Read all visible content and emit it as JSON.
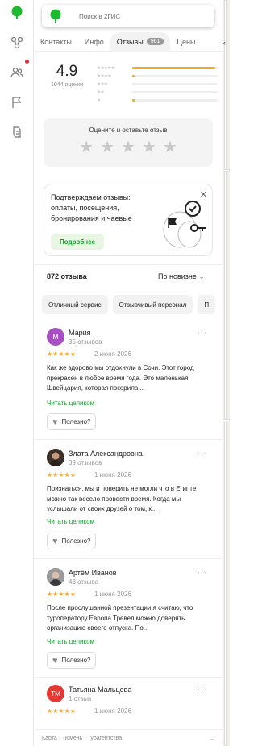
{
  "search": {
    "placeholder": "Поиск в 2ГИС"
  },
  "tabs": [
    {
      "label": "Контакты"
    },
    {
      "label": "Инфо"
    },
    {
      "label": "Отзывы",
      "badge": "961",
      "active": true
    },
    {
      "label": "Цены"
    }
  ],
  "rating": {
    "value": "4.9",
    "count_label": "1044 оценки",
    "distribution": [
      {
        "stars": "★★★★★",
        "fraction": 0.97
      },
      {
        "stars": "★★★★",
        "fraction": 0.03
      },
      {
        "stars": "★★★",
        "fraction": 0.0
      },
      {
        "stars": "★★",
        "fraction": 0.0
      },
      {
        "stars": "★",
        "fraction": 0.03
      }
    ]
  },
  "rate_box": {
    "title": "Оцените и оставьте отзыв"
  },
  "promo": {
    "text": "Подтверждаем отзывы: оплаты, посещения, бронирования и чаевые",
    "button": "Подробнее"
  },
  "reviews_header": {
    "count": "872 отзыва",
    "sort": "По новизне"
  },
  "chips": [
    "Отличный сервис",
    "Отзывчивый персонал",
    "П"
  ],
  "reviews": [
    {
      "initial": "М",
      "avatar_color": "#a94fc5",
      "name": "Мария",
      "sub": "35 отзывов",
      "stars": "★★★★★",
      "date": "2 июня 2026",
      "text": "Как же здорово мы отдохнули в Сочи. Этот город прекрасен в любое время года. Это маленькая Швейцария, которая покорила...",
      "read_more": "Читать целиком",
      "useful": "Полезно?"
    },
    {
      "initial": "",
      "avatar_color": "#5a4a3c",
      "name": "Злата Александровна",
      "sub": "39 отзывов",
      "stars": "★★★★★",
      "date": "1 июня 2026",
      "text": "Признаться, мы и поверить не могли что в Египте можно так весело провести время. Когда мы услышали от своих друзей о том, к...",
      "read_more": "Читать целиком",
      "useful": "Полезно?"
    },
    {
      "initial": "",
      "avatar_color": "#6b6b6b",
      "name": "Артём Иванов",
      "sub": "43 отзыва",
      "stars": "★★★★★",
      "date": "1 июня 2026",
      "text": "После прослушанной презентации я считаю, что туроператору Европа Тревел можно доверять организацию своего отпуска. По...",
      "read_more": "Читать целиком",
      "useful": "Полезно?"
    },
    {
      "initial": "ТМ",
      "avatar_color": "#e53935",
      "name": "Татьяна Мальцева",
      "sub": "1 отзыв",
      "stars": "★★★★★",
      "date": "1 июня 2026",
      "text": "",
      "read_more": "",
      "useful": ""
    }
  ],
  "footer": {
    "text": "Карта · Тюмень · Турагентства",
    "dots": "..."
  }
}
